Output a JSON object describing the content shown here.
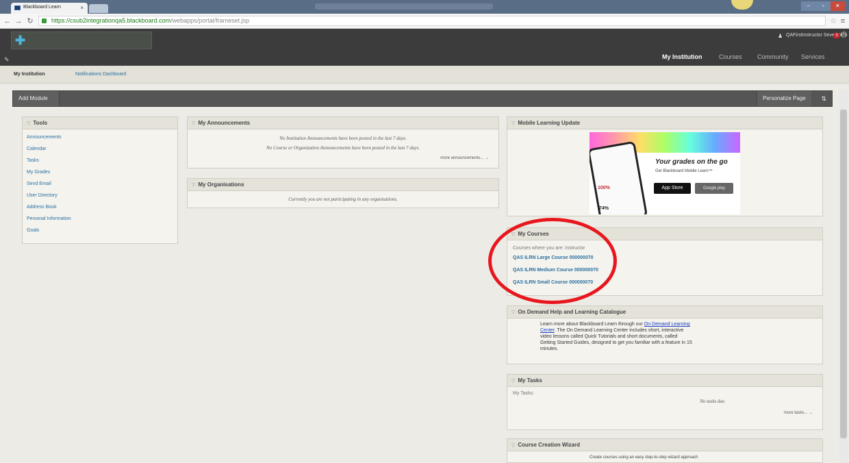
{
  "browser": {
    "tab_title": "Blackboard Learn",
    "tab_close": "×",
    "url_scheme": "https://",
    "url_host": "csub2integrationqa5.blackboard.com",
    "url_path": "/webapps/portal/frameset.jsp"
  },
  "header": {
    "user_name": "QAFirstInstructor SevenZero",
    "notification_count": "3",
    "tabs": [
      "My Institution",
      "Courses",
      "Community",
      "Services"
    ]
  },
  "subnav": {
    "tabs": [
      "My Institution",
      "Notifications Dashboard"
    ]
  },
  "toolbar": {
    "add_module": "Add Module",
    "personalize": "Personalize Page",
    "reorder_icon": "⇅"
  },
  "tools": {
    "title": "Tools",
    "items": [
      "Announcements",
      "Calendar",
      "Tasks",
      "My Grades",
      "Send Email",
      "User Directory",
      "Address Book",
      "Personal Information",
      "Goals"
    ]
  },
  "announcements": {
    "title": "My Announcements",
    "msg1": "No Institution Announcements have been posted in the last 7 days.",
    "msg2": "No Course or Organization Announcements have been posted in the last 7 days.",
    "more": "more announcements... →"
  },
  "organisations": {
    "title": "My Organisations",
    "msg": "Currently you are not participating in any organisations."
  },
  "mobile": {
    "title": "Mobile Learning Update",
    "headline": "Your grades on the go",
    "sub": "Get Blackboard Mobile Learn™",
    "appstore": "App Store",
    "google": "Google play",
    "stat1": "100%",
    "stat2": "74%"
  },
  "courses": {
    "title": "My Courses",
    "role_label": "Courses where you are: Instructor",
    "items": [
      "QAS ILRN Large Course 000000070",
      "QAS ILRN Medium Course 000000070",
      "QAS ILRN Small Course 000000070"
    ]
  },
  "ondemand": {
    "title": "On Demand Help and Learning Catalogue",
    "text_before": "Learn more about Blackboard Learn through our ",
    "link": "On Demand Learning Center",
    "text_after": ". The On Demand Learning Center includes short, interactive video lessons called Quick Tutorials and short documents, called Getting Started Guides, designed to get you familiar with a feature in 15 minutes."
  },
  "mytasks": {
    "title": "My Tasks",
    "label": "My Tasks:",
    "empty": "No tasks due.",
    "more": "more tasks... →"
  },
  "wizard": {
    "title": "Course Creation Wizard",
    "text": "Create courses using an easy step-to-step wizard approach"
  }
}
